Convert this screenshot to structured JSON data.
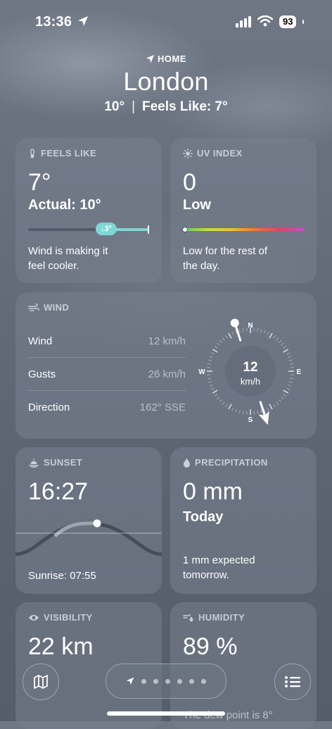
{
  "status": {
    "time": "13:36",
    "battery": "93"
  },
  "header": {
    "home_label": "HOME",
    "city": "London",
    "temp": "10°",
    "feels_like": "Feels Like: 7°"
  },
  "feels_like": {
    "title": "FEELS LIKE",
    "value": "7°",
    "actual": "Actual: 10°",
    "delta_badge": "↓3°",
    "desc_line1": "Wind is making it",
    "desc_line2": "feel cooler."
  },
  "uv": {
    "title": "UV INDEX",
    "value": "0",
    "level": "Low",
    "desc_line1": "Low for the rest of",
    "desc_line2": "the day.",
    "fraction": 0.0
  },
  "wind": {
    "title": "WIND",
    "rows": [
      {
        "label": "Wind",
        "value": "12 km/h"
      },
      {
        "label": "Gusts",
        "value": "26 km/h"
      },
      {
        "label": "Direction",
        "value": "162° SSE"
      }
    ],
    "compass": {
      "speed": "12",
      "unit": "km/h",
      "n": "N",
      "e": "E",
      "s": "S",
      "w": "W",
      "direction_deg": 162
    }
  },
  "sunset": {
    "title": "SUNSET",
    "value": "16:27",
    "sunrise": "Sunrise: 07:55"
  },
  "precipitation": {
    "title": "PRECIPITATION",
    "value": "0 mm",
    "period": "Today",
    "desc_line1": "1 mm expected",
    "desc_line2": "tomorrow."
  },
  "visibility": {
    "title": "VISIBILITY",
    "value": "22 km"
  },
  "humidity": {
    "title": "HUMIDITY",
    "value": "89 %",
    "dew_point": "The dew point is 8°"
  },
  "pager": {
    "page_count": 6,
    "active_index": 0
  },
  "colors": {
    "accent_feels": "#7fd6d6",
    "card_bg": "rgba(120,128,142,0.55)"
  }
}
